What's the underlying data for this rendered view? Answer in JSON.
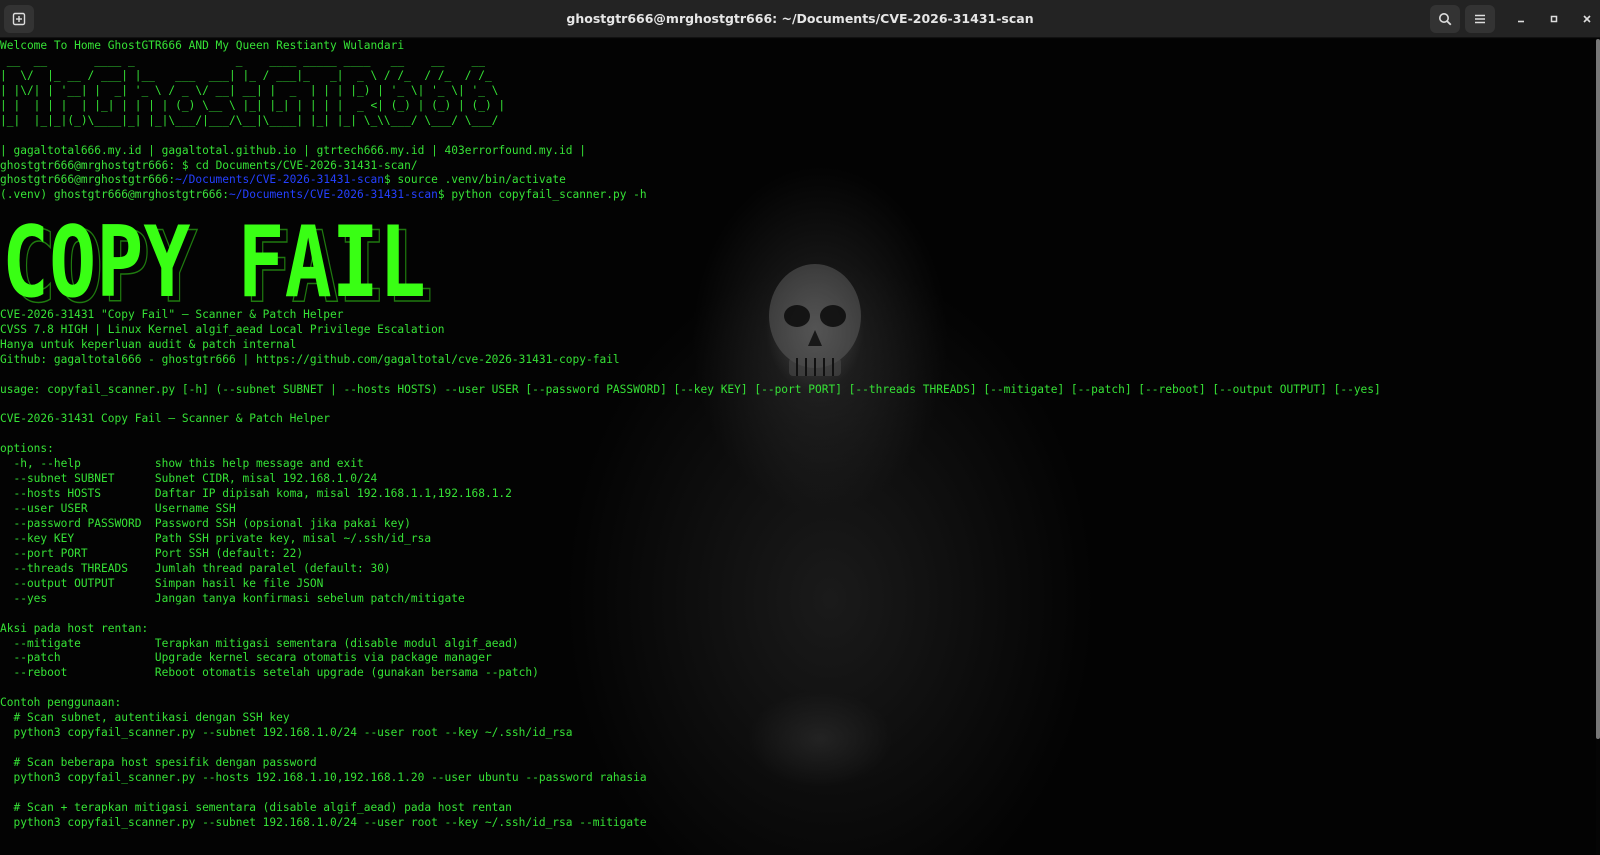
{
  "window": {
    "title": "ghostgtr666@mrghostgtr666: ~/Documents/CVE-2026-31431-scan",
    "new_tab_icon": "new-tab-icon",
    "search_icon": "search-icon",
    "menu_icon": "hamburger-menu-icon",
    "minimize_icon": "minimize-icon",
    "maximize_icon": "maximize-icon",
    "close_icon": "close-icon"
  },
  "terminal": {
    "colors": {
      "text": "#36e236",
      "path": "#2540ff",
      "banner": "#39ff14",
      "background": "#050505"
    },
    "welcome": "Welcome To Home GhostGTR666 AND My Queen Restianty Wulandari",
    "ascii_art": [
      " __  __       ____ _               _    ____ _____ ____   __    __    __",
      "|  \\/  |_ __ / ___| |__   ___  ___| |_ / ___|_   _|  _ \\ / /_  / /_  / /_",
      "| |\\/| | '__| |  _| '_ \\ / _ \\/ __| __| |  _  | | | |_) | '_ \\| '_ \\| '_ \\",
      "| |  | | |  | |_| | | | | (_) \\__ \\ |_| |_| | | | |  _ <| (_) | (_) | (_) |",
      "|_|  |_|_|(_)\\____|_| |_|\\___/|___/\\__|\\____| |_| |_| \\_\\\\___/ \\___/ \\___/"
    ],
    "links_line": "| gagaltotal666.my.id | gagaltotal.github.io | gtrtech666.my.id | 403errorfound.my.id |",
    "commands": [
      {
        "prefix": "",
        "user": "ghostgtr666@mrghostgtr666",
        "sep": ":",
        "path": " ",
        "cmd": "$ cd Documents/CVE-2026-31431-scan/"
      },
      {
        "prefix": "",
        "user": "ghostgtr666@mrghostgtr666",
        "sep": ":",
        "path": "~/Documents/CVE-2026-31431-scan",
        "cmd": "$ source .venv/bin/activate"
      },
      {
        "prefix": "(.venv) ",
        "user": "ghostgtr666@mrghostgtr666",
        "sep": ":",
        "path": "~/Documents/CVE-2026-31431-scan",
        "cmd": "$ python copyfail_scanner.py -h"
      }
    ],
    "banner_text": "COPY FAIL",
    "info_lines": [
      "CVE-2026-31431 \"Copy Fail\" — Scanner & Patch Helper",
      "CVSS 7.8 HIGH | Linux Kernel algif_aead Local Privilege Escalation",
      "Hanya untuk keperluan audit & patch internal",
      "Github: gagaltotal666 - ghostgtr666 | https://github.com/gagaltotal/cve-2026-31431-copy-fail"
    ],
    "usage": "usage: copyfail_scanner.py [-h] (--subnet SUBNET | --hosts HOSTS) --user USER [--password PASSWORD] [--key KEY] [--port PORT] [--threads THREADS] [--mitigate] [--patch] [--reboot] [--output OUTPUT] [--yes]",
    "description": "CVE-2026-31431 Copy Fail — Scanner & Patch Helper",
    "options_header": "options:",
    "options": [
      {
        "flag": "  -h, --help           ",
        "desc": "show this help message and exit"
      },
      {
        "flag": "  --subnet SUBNET      ",
        "desc": "Subnet CIDR, misal 192.168.1.0/24"
      },
      {
        "flag": "  --hosts HOSTS        ",
        "desc": "Daftar IP dipisah koma, misal 192.168.1.1,192.168.1.2"
      },
      {
        "flag": "  --user USER          ",
        "desc": "Username SSH"
      },
      {
        "flag": "  --password PASSWORD  ",
        "desc": "Password SSH (opsional jika pakai key)"
      },
      {
        "flag": "  --key KEY            ",
        "desc": "Path SSH private key, misal ~/.ssh/id_rsa"
      },
      {
        "flag": "  --port PORT          ",
        "desc": "Port SSH (default: 22)"
      },
      {
        "flag": "  --threads THREADS    ",
        "desc": "Jumlah thread paralel (default: 30)"
      },
      {
        "flag": "  --output OUTPUT      ",
        "desc": "Simpan hasil ke file JSON"
      },
      {
        "flag": "  --yes                ",
        "desc": "Jangan tanya konfirmasi sebelum patch/mitigate"
      }
    ],
    "actions_header": "Aksi pada host rentan:",
    "actions": [
      {
        "flag": "  --mitigate           ",
        "desc": "Terapkan mitigasi sementara (disable modul algif_aead)"
      },
      {
        "flag": "  --patch              ",
        "desc": "Upgrade kernel secara otomatis via package manager"
      },
      {
        "flag": "  --reboot             ",
        "desc": "Reboot otomatis setelah upgrade (gunakan bersama --patch)"
      }
    ],
    "examples_header": "Contoh penggunaan:",
    "examples": [
      {
        "comment": "  # Scan subnet, autentikasi dengan SSH key",
        "cmd": "  python3 copyfail_scanner.py --subnet 192.168.1.0/24 --user root --key ~/.ssh/id_rsa"
      },
      {
        "comment": "  # Scan beberapa host spesifik dengan password",
        "cmd": "  python3 copyfail_scanner.py --hosts 192.168.1.10,192.168.1.20 --user ubuntu --password rahasia"
      },
      {
        "comment": "  # Scan + terapkan mitigasi sementara (disable algif_aead) pada host rentan",
        "cmd": "  python3 copyfail_scanner.py --subnet 192.168.1.0/24 --user root --key ~/.ssh/id_rsa --mitigate"
      }
    ]
  }
}
